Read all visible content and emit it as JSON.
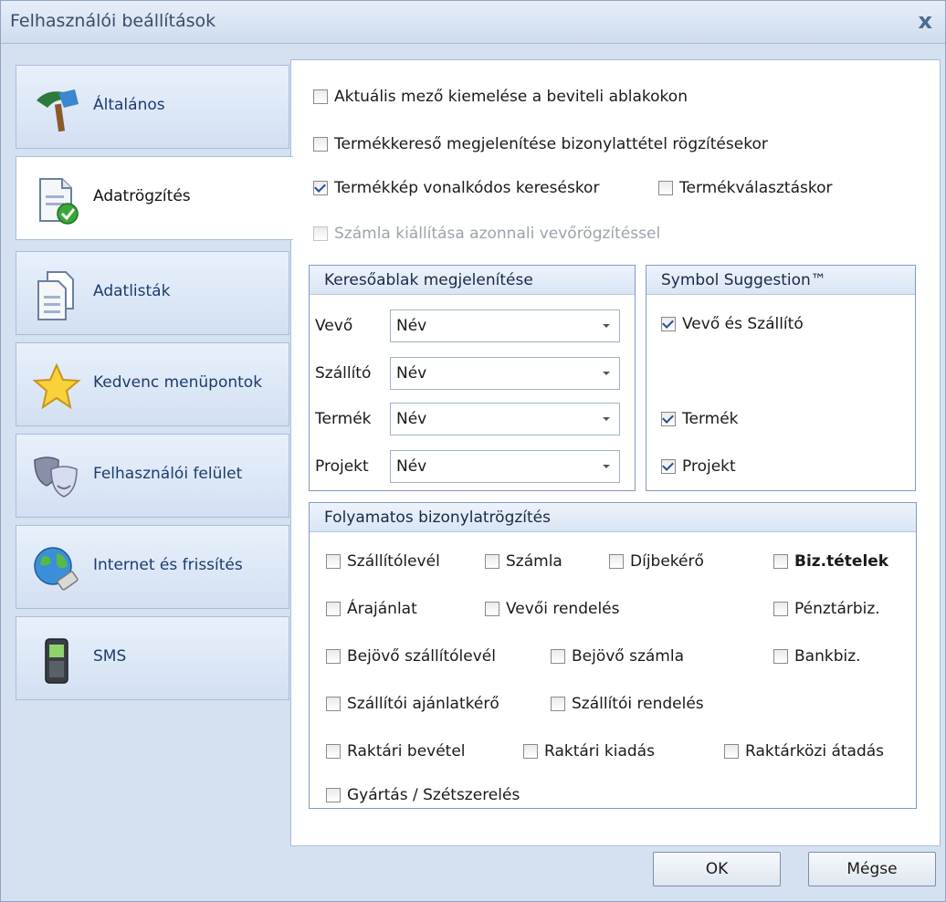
{
  "window": {
    "title": "Felhasználói beállítások",
    "close_glyph": "x"
  },
  "sidebar": {
    "items": [
      {
        "label": "Általános",
        "icon": "hammer-icon"
      },
      {
        "label": "Adatrögzítés",
        "icon": "document-check-icon",
        "active": true
      },
      {
        "label": "Adatlisták",
        "icon": "documents-icon"
      },
      {
        "label": "Kedvenc menüpontok",
        "icon": "star-icon"
      },
      {
        "label": "Felhasználói felület",
        "icon": "masks-icon"
      },
      {
        "label": "Internet és frissítés",
        "icon": "globe-plug-icon"
      },
      {
        "label": "SMS",
        "icon": "mobile-phone-icon"
      }
    ]
  },
  "options": {
    "highlight_field": "Aktuális mező kiemelése a beviteli ablakokon",
    "product_finder": "Termékkereső megjelenítése bizonylattétel rögzítésekor",
    "product_image_barcode": "Termékkép vonalkódos kereséskor",
    "product_selection": "Termékválasztáskor",
    "invoice_immediate": "Számla kiállítása azonnali vevőrögzítéssel"
  },
  "search_window": {
    "title": "Keresőablak megjelenítése",
    "rows": [
      {
        "label": "Vevő",
        "value": "Név"
      },
      {
        "label": "Szállító",
        "value": "Név"
      },
      {
        "label": "Termék",
        "value": "Név"
      },
      {
        "label": "Projekt",
        "value": "Név"
      }
    ]
  },
  "symbol": {
    "title": "Symbol Suggestion™",
    "customer_supplier": "Vevő és Szállító",
    "product": "Termék",
    "project": "Projekt"
  },
  "continuous": {
    "title": "Folyamatos bizonylatrögzítés",
    "items": {
      "szallitolevel": "Szállítólevél",
      "szamla": "Számla",
      "dijbekero": "Díjbekérő",
      "biz_tetelek": "Biz.tételek",
      "arajanlat": "Árajánlat",
      "vevoi_rendeles": "Vevői rendelés",
      "penztarbiz": "Pénztárbiz.",
      "bejovo_szallitolevel": "Bejövő szállítólevél",
      "bejovo_szamla": "Bejövő számla",
      "bankbiz": "Bankbiz.",
      "szallitoi_ajanlatkero": "Szállítói ajánlatkérő",
      "szallitoi_rendeles": "Szállítói rendelés",
      "raktari_bevetel": "Raktári bevétel",
      "raktari_kiadas": "Raktári kiadás",
      "raktarkozi_atadas": "Raktárközi átadás",
      "gyartas": "Gyártás / Szétszerelés"
    }
  },
  "buttons": {
    "ok": "OK",
    "cancel": "Mégse"
  }
}
